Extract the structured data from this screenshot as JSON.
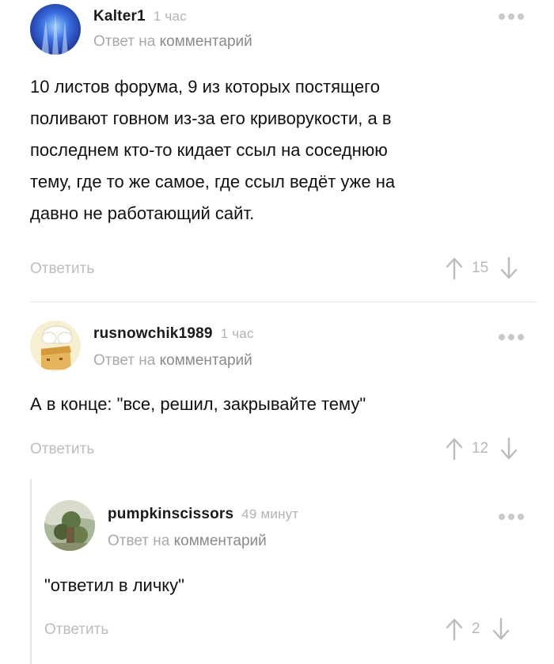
{
  "comments": [
    {
      "username": "Kalter1",
      "time": "1 час",
      "reply_prefix": "Ответ на",
      "reply_link": "комментарий",
      "lines": [
        "10 листов форума, 9 из которых постящего",
        "поливают говном из-за его криворукости, а в",
        "последнем кто-то кидает ссыл на соседнюю",
        "тему, где то же самое, где ссыл ведёт уже на",
        "давно не работающий сайт."
      ],
      "reply_label": "Ответить",
      "votes": "15"
    },
    {
      "username": "rusnowchik1989",
      "time": "1 час",
      "reply_prefix": "Ответ на",
      "reply_link": "комментарий",
      "lines": [
        "А в конце: \"все, решил, закрывайте тему\""
      ],
      "reply_label": "Ответить",
      "votes": "12"
    },
    {
      "username": "pumpkinscissors",
      "time": "49 минут",
      "reply_prefix": "Ответ на",
      "reply_link": "комментарий",
      "lines": [
        "\"ответил в личку\""
      ],
      "reply_label": "Ответить",
      "votes": "2"
    }
  ],
  "colors": {
    "muted": "#a9a9a9",
    "separator": "#e6e6e6",
    "thread_line": "#e4e4e4"
  },
  "icons": [
    "more-dots-icon",
    "arrow-up-icon",
    "arrow-down-icon"
  ]
}
